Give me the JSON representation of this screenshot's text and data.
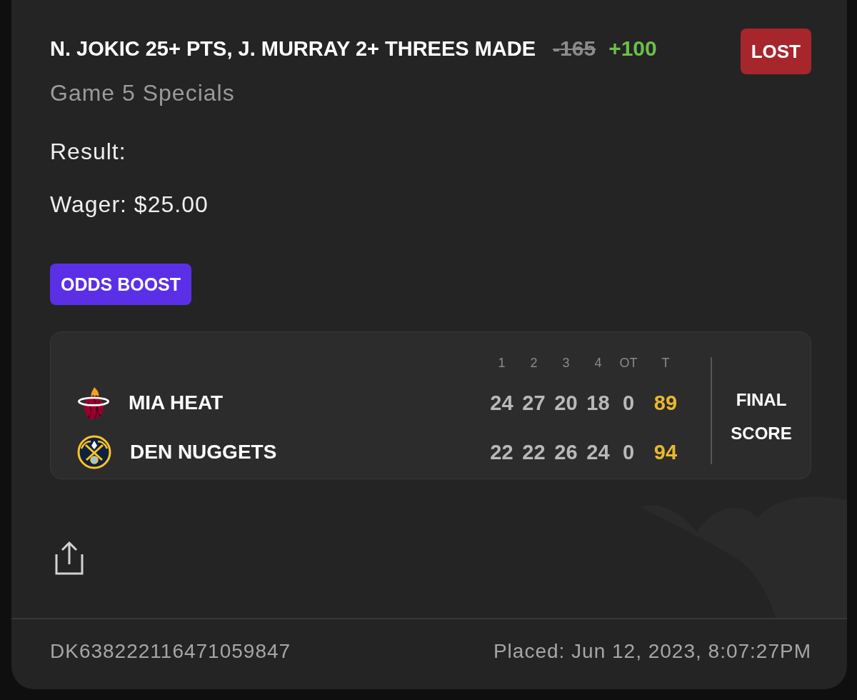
{
  "bet": {
    "title": "N. JOKIC 25+ PTS, J. MURRAY 2+ THREES MADE",
    "original_odds": "-165",
    "boosted_odds": "+100",
    "status": {
      "label": "LOST",
      "kind": "lost"
    },
    "market": "Game 5 Specials"
  },
  "details": [
    "Result:",
    "Wager: $25.00"
  ],
  "tags": [
    {
      "label": "ODDS BOOST",
      "kind": "boost"
    }
  ],
  "scoreboard": {
    "periods": [
      "1",
      "2",
      "3",
      "4",
      "OT",
      "T"
    ],
    "teams": [
      {
        "name": "MIA HEAT",
        "kind": "flame",
        "scores": [
          "24",
          "27",
          "20",
          "18",
          "0"
        ],
        "total": "89"
      },
      {
        "name": "DEN NUGGETS",
        "kind": "pickaxe",
        "scores": [
          "22",
          "22",
          "26",
          "24",
          "0"
        ],
        "total": "94"
      }
    ],
    "status": "FINAL SCORE"
  },
  "footer": {
    "bet_id": "DK638222116471059847",
    "placed": "Placed: Jun 12, 2023, 8:07:27PM"
  }
}
